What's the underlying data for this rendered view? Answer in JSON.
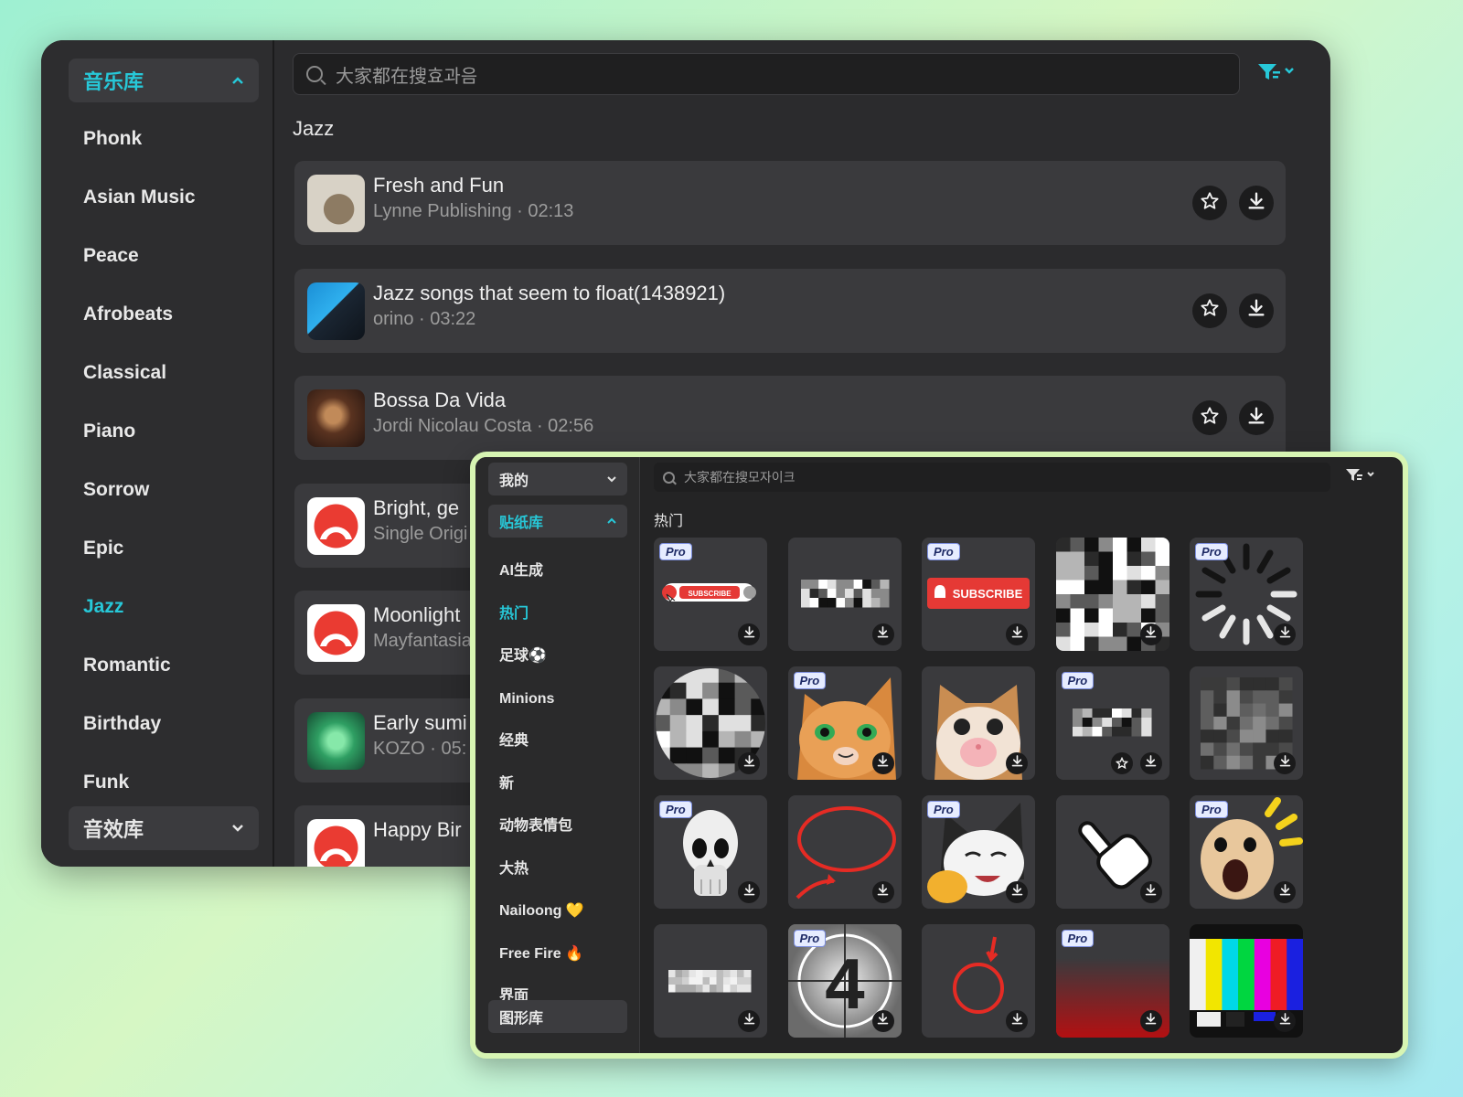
{
  "music": {
    "sidebar": {
      "library_label": "音乐库",
      "items": [
        "Phonk",
        "Asian Music",
        "Peace",
        "Afrobeats",
        "Classical",
        "Piano",
        "Sorrow",
        "Epic",
        "Jazz",
        "Romantic",
        "Birthday",
        "Funk"
      ],
      "selected": "Jazz",
      "sfx_label": "音效库"
    },
    "search_placeholder": "大家都在搜효과음",
    "category_title": "Jazz",
    "tracks": [
      {
        "title": "Fresh and Fun",
        "subtitle": "Lynne Publishing · 02:13"
      },
      {
        "title": "Jazz songs that seem to float(1438921)",
        "subtitle": "orino · 03:22"
      },
      {
        "title": "Bossa Da Vida",
        "subtitle": "Jordi Nicolau Costa · 02:56"
      },
      {
        "title": "Bright, ge",
        "subtitle": "Single Origi"
      },
      {
        "title": "Moonlight",
        "subtitle": "Mayfantasia"
      },
      {
        "title": "Early sumi",
        "subtitle": "KOZO · 05:"
      },
      {
        "title": "Happy Bir",
        "subtitle": ""
      }
    ],
    "accent_color": "#27c8d8"
  },
  "stickers": {
    "sidebar": {
      "mine_label": "我的",
      "library_label": "贴纸库",
      "items": [
        "AI生成",
        "热门",
        "足球⚽",
        "Minions",
        "经典",
        "新",
        "动物表情包",
        "大热",
        "Nailoong 💛",
        "Free Fire 🔥",
        "界面"
      ],
      "selected": "热门",
      "shapes_label": "图形库"
    },
    "search_placeholder": "大家都在搜모자이크",
    "category_title": "热门",
    "pro_label": "Pro",
    "subscribe_label": "SUBSCRIBE",
    "countdown_digit": "4",
    "tiles": [
      {
        "art": "subscribe-small-icon",
        "pro": true
      },
      {
        "art": "mosaic-strip-icon",
        "pro": false
      },
      {
        "art": "subscribe-bell-icon",
        "pro": true
      },
      {
        "art": "mosaic-square-icon",
        "pro": false
      },
      {
        "art": "loading-spinner-icon",
        "pro": true
      },
      {
        "art": "mosaic-circle-icon",
        "pro": false
      },
      {
        "art": "cat-shocked-icon",
        "pro": true
      },
      {
        "art": "cat-face-icon",
        "pro": false
      },
      {
        "art": "mosaic-small-icon",
        "pro": true
      },
      {
        "art": "mosaic-dark-icon",
        "pro": false
      },
      {
        "art": "skull-icon",
        "pro": true
      },
      {
        "art": "red-circle-arrow-icon",
        "pro": false
      },
      {
        "art": "cat-pointing-icon",
        "pro": true
      },
      {
        "art": "pointing-hand-icon",
        "pro": false
      },
      {
        "art": "screaming-dog-icon",
        "pro": true
      },
      {
        "art": "mosaic-bar-icon",
        "pro": false
      },
      {
        "art": "countdown-icon",
        "pro": true
      },
      {
        "art": "red-ring-icon",
        "pro": false
      },
      {
        "art": "red-gradient-icon",
        "pro": true
      },
      {
        "art": "tv-color-bars-icon",
        "pro": false
      }
    ]
  }
}
